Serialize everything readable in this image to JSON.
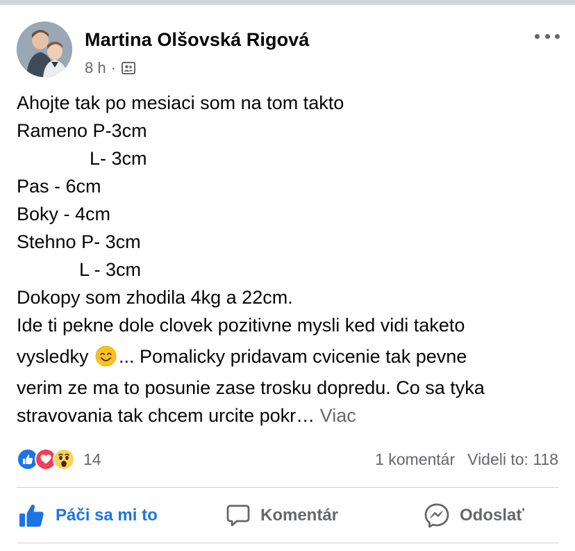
{
  "post": {
    "author": "Martina Olšovská Rigová",
    "time": "8 h",
    "separator": "·",
    "audience_icon": "friends-icon",
    "more_icon": "more-horizontal-icon",
    "lines": [
      "Ahojte tak po mesiaci som na tom takto",
      "Rameno P-3cm",
      "              L- 3cm",
      "Pas - 6cm",
      "Boky - 4cm",
      "Stehno P- 3cm",
      "            L - 3cm",
      "Dokopy som zhodila 4kg a 22cm.",
      "Ide ti pekne dole clovek pozitivne mysli ked vidi taketo",
      "vysledky ",
      "verim ze ma to posunie zase trosku dopredu. Co sa tyka",
      "stravovania tak chcem urcite pokr… "
    ],
    "emoji_icon": "smiling-face-emoji",
    "after_emoji": "... Pomalicky pridavam cvicenie tak pevne",
    "see_more": "Viac"
  },
  "reactions": {
    "icons": [
      "like-reaction-icon",
      "love-reaction-icon",
      "wow-reaction-icon"
    ],
    "count": "14"
  },
  "stats": {
    "comments": "1 komentár",
    "views": "Videli to: 118"
  },
  "actions": {
    "like": "Páči sa mi to",
    "comment": "Komentár",
    "share": "Odoslať"
  },
  "colors": {
    "facebook_blue": "#1b74e4",
    "secondary_text": "#65676b",
    "divider": "#ced0d4",
    "love_red": "#f33e58",
    "wow_yellow": "#f7d359"
  }
}
